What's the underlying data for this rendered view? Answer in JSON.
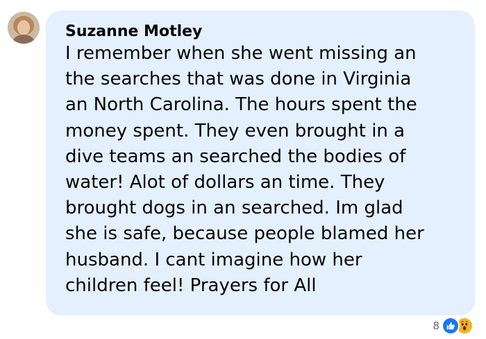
{
  "comment": {
    "author": "Suzanne Motley",
    "lines": [
      "I remember when she went missing an",
      "the searches that was done in Virginia",
      "an North Carolina. The hours spent the",
      "money spent. They even brought in a",
      "dive teams an searched the bodies of",
      "water! Alot of dollars an time. They",
      "brought dogs in an searched. Im glad",
      "she is safe, because people blamed her",
      "husband. I cant imagine how her",
      "children feel! Prayers for All"
    ],
    "reactions": {
      "count": "8",
      "icons": [
        "like-icon",
        "wow-icon"
      ]
    }
  },
  "colors": {
    "bubble": "#e4f0fd",
    "text": "#050505",
    "like": "#1877f2",
    "wow": "#f7b125"
  }
}
